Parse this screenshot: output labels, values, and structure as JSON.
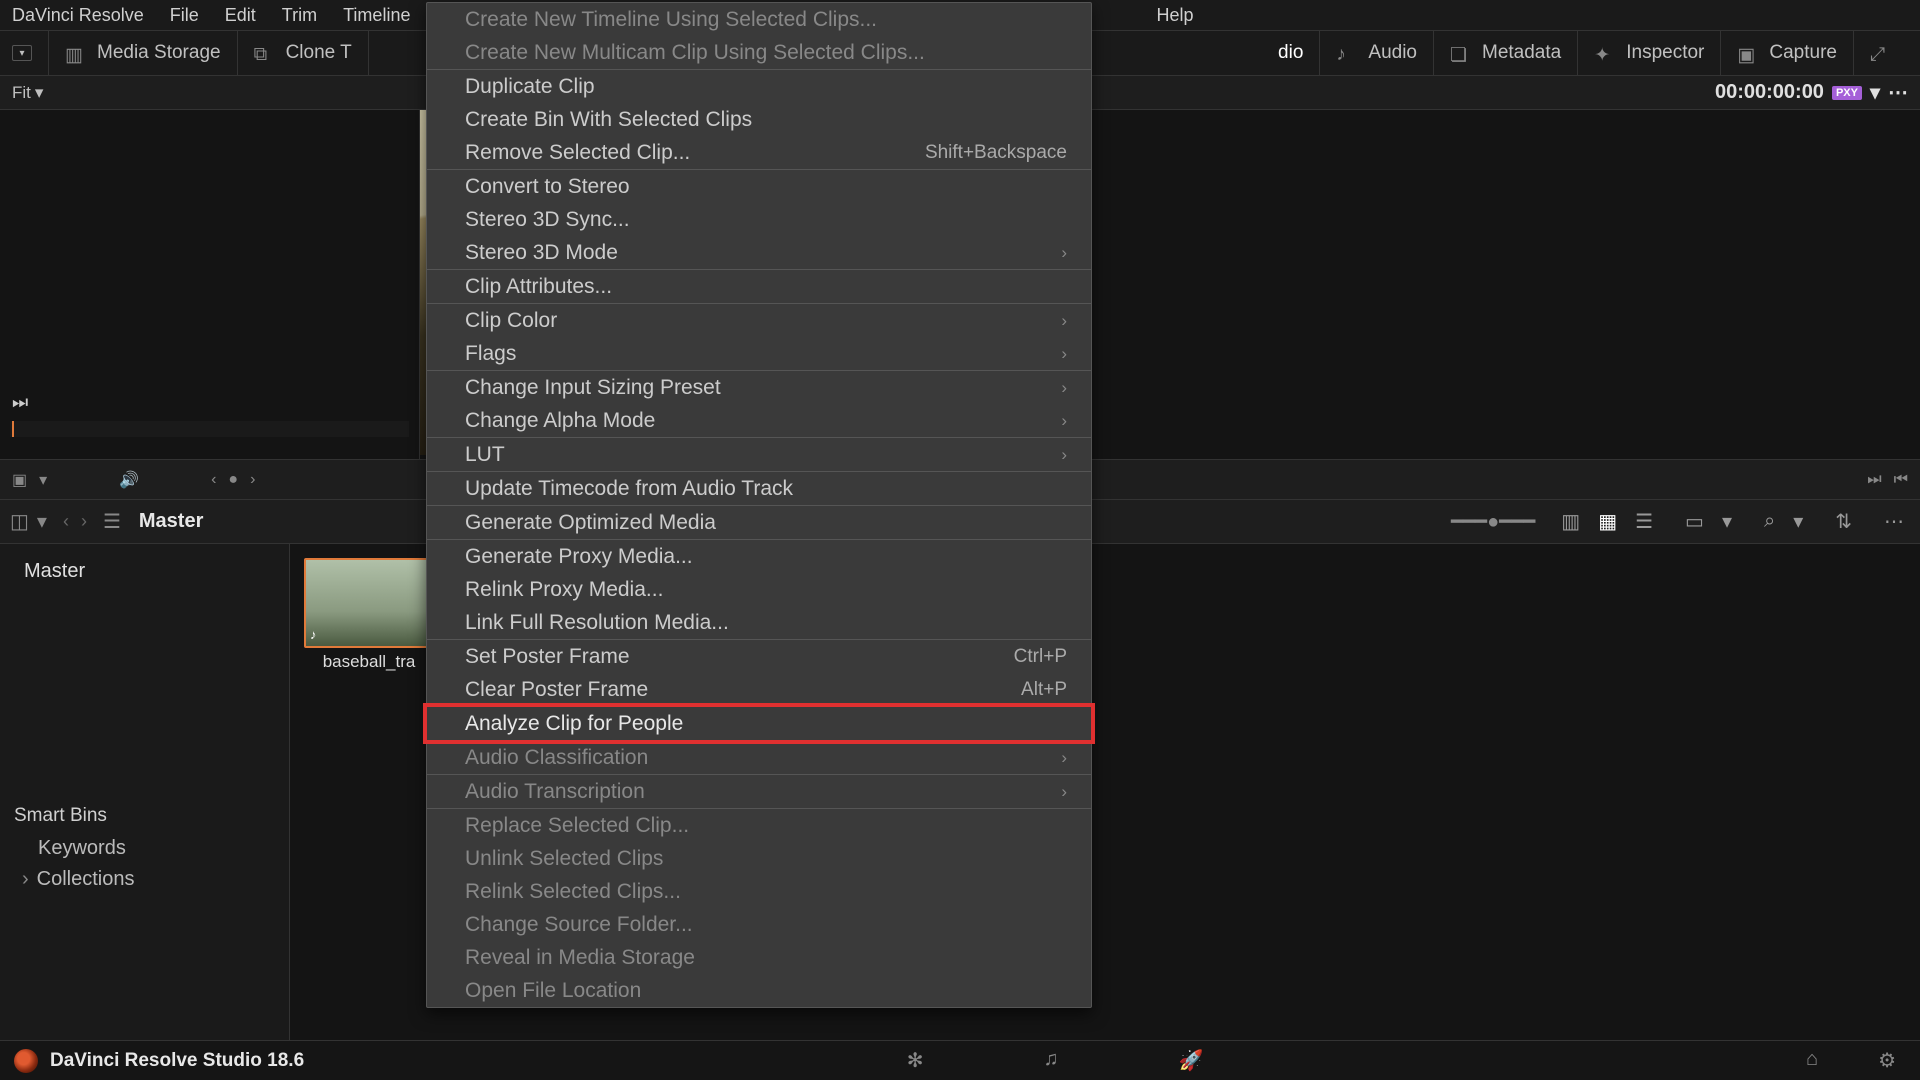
{
  "menubar": [
    "DaVinci Resolve",
    "File",
    "Edit",
    "Trim",
    "Timeline",
    "Help"
  ],
  "toolbar": {
    "media_storage": "Media Storage",
    "clone_tool": "Clone T",
    "audio_tab": "dio",
    "audio": "Audio",
    "metadata": "Metadata",
    "inspector": "Inspector",
    "capture": "Capture"
  },
  "viewerbar": {
    "fit": "Fit",
    "timecode": "00:00:00:00",
    "proxy_badge": "PXY"
  },
  "poolheader": {
    "master": "Master"
  },
  "sidebar": {
    "master": "Master",
    "smartbins_hdr": "Smart Bins",
    "keywords": "Keywords",
    "collections": "Collections"
  },
  "clip": {
    "name": "baseball_tra"
  },
  "context_menu": {
    "groups": [
      [
        {
          "label": "Create New Timeline Using Selected Clips...",
          "dim": true
        },
        {
          "label": "Create New Multicam Clip Using Selected Clips...",
          "dim": true
        }
      ],
      [
        {
          "label": "Duplicate Clip"
        },
        {
          "label": "Create Bin With Selected Clips"
        },
        {
          "label": "Remove Selected Clip...",
          "shortcut": "Shift+Backspace"
        }
      ],
      [
        {
          "label": "Convert to Stereo"
        },
        {
          "label": "Stereo 3D Sync..."
        },
        {
          "label": "Stereo 3D Mode",
          "submenu": true
        }
      ],
      [
        {
          "label": "Clip Attributes..."
        }
      ],
      [
        {
          "label": "Clip Color",
          "submenu": true
        },
        {
          "label": "Flags",
          "submenu": true
        }
      ],
      [
        {
          "label": "Change Input Sizing Preset",
          "submenu": true
        },
        {
          "label": "Change Alpha Mode",
          "submenu": true
        }
      ],
      [
        {
          "label": "LUT",
          "submenu": true
        }
      ],
      [
        {
          "label": "Update Timecode from Audio Track"
        }
      ],
      [
        {
          "label": "Generate Optimized Media"
        }
      ],
      [
        {
          "label": "Generate Proxy Media..."
        },
        {
          "label": "Relink Proxy Media..."
        },
        {
          "label": "Link Full Resolution Media..."
        }
      ],
      [
        {
          "label": "Set Poster Frame",
          "shortcut": "Ctrl+P"
        },
        {
          "label": "Clear Poster Frame",
          "shortcut": "Alt+P"
        }
      ],
      [
        {
          "label": "Analyze Clip for People",
          "highlight": true,
          "bright": true
        }
      ],
      [
        {
          "label": "Audio Classification",
          "submenu": true,
          "dim": true
        }
      ],
      [
        {
          "label": "Audio Transcription",
          "submenu": true,
          "dim": true
        }
      ],
      [
        {
          "label": "Replace Selected Clip...",
          "dim": true
        },
        {
          "label": "Unlink Selected Clips",
          "dim": true
        },
        {
          "label": "Relink Selected Clips...",
          "dim": true
        },
        {
          "label": "Change Source Folder...",
          "dim": true
        },
        {
          "label": "Reveal in Media Storage",
          "dim": true
        },
        {
          "label": "Open File Location",
          "dim": true
        }
      ]
    ]
  },
  "footer": {
    "app_title": "DaVinci Resolve Studio 18.6"
  }
}
